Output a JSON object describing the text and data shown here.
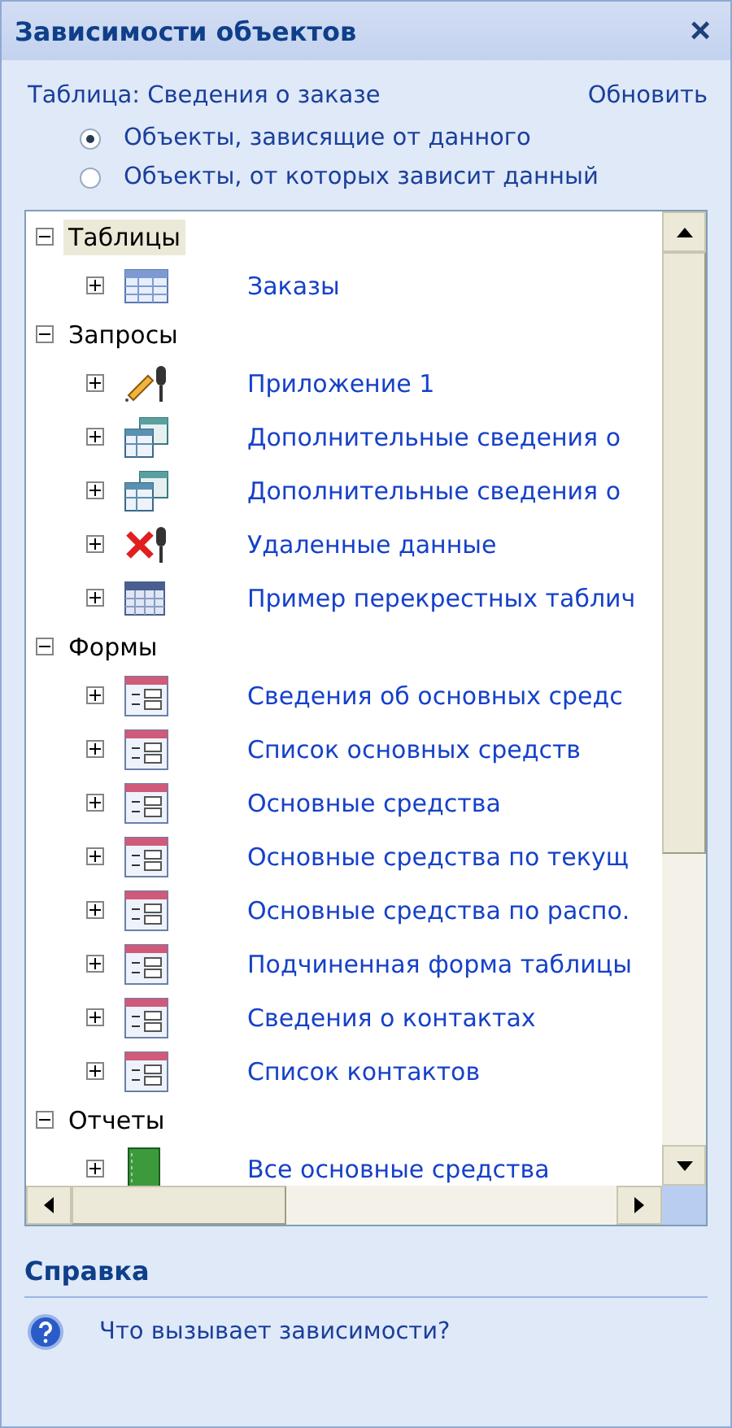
{
  "window": {
    "title": "Зависимости объектов",
    "close": "×"
  },
  "object": {
    "label": "Таблица: Сведения о заказе",
    "refresh": "Обновить"
  },
  "options": [
    {
      "label": "Объекты, зависящие от данного",
      "selected": true
    },
    {
      "label": "Объекты, от которых зависит данный",
      "selected": false
    }
  ],
  "tree": [
    {
      "label": "Таблицы",
      "expanded": true,
      "selected": true,
      "children": [
        {
          "label": "Заказы",
          "kind": "table",
          "expanded": false,
          "selected": false
        }
      ]
    },
    {
      "label": "Запросы",
      "expanded": true,
      "selected": false,
      "children": [
        {
          "label": "Приложение 1",
          "kind": "append",
          "expanded": false,
          "selected": false
        },
        {
          "label": "Дополнительные сведения о",
          "kind": "select",
          "expanded": false,
          "selected": false
        },
        {
          "label": "Дополнительные сведения о",
          "kind": "select",
          "expanded": false,
          "selected": false
        },
        {
          "label": "Удаленные данные",
          "kind": "delete",
          "expanded": false,
          "selected": false
        },
        {
          "label": "Пример перекрестных таблич",
          "kind": "crosstab",
          "expanded": false,
          "selected": false
        }
      ]
    },
    {
      "label": "Формы",
      "expanded": true,
      "selected": false,
      "children": [
        {
          "label": "Сведения об основных средс",
          "kind": "form",
          "expanded": false,
          "selected": false
        },
        {
          "label": "Список основных средств",
          "kind": "form",
          "expanded": false,
          "selected": false
        },
        {
          "label": "Основные средства",
          "kind": "form",
          "expanded": false,
          "selected": false
        },
        {
          "label": "Основные средства по текущ",
          "kind": "form",
          "expanded": false,
          "selected": false
        },
        {
          "label": "Основные средства по распо.",
          "kind": "form",
          "expanded": false,
          "selected": false
        },
        {
          "label": "Подчиненная форма таблицы",
          "kind": "form",
          "expanded": false,
          "selected": false
        },
        {
          "label": "Сведения о контактах",
          "kind": "form",
          "expanded": false,
          "selected": false
        },
        {
          "label": "Список контактов",
          "kind": "form",
          "expanded": false,
          "selected": false
        }
      ]
    },
    {
      "label": "Отчеты",
      "expanded": true,
      "selected": false,
      "children": [
        {
          "label": "Все основные средства",
          "kind": "report",
          "expanded": false,
          "selected": false
        }
      ]
    }
  ],
  "help": {
    "title": "Справка",
    "link": "Что вызывает зависимости?"
  }
}
